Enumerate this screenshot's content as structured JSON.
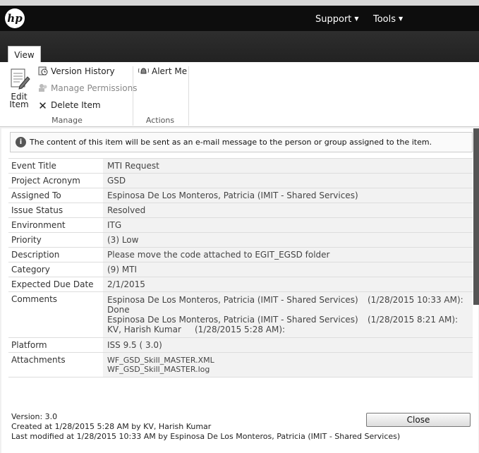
{
  "header": {
    "logo_text": "hp",
    "nav": [
      {
        "label": "Support"
      },
      {
        "label": "Tools"
      }
    ]
  },
  "ribbon": {
    "tabs": [
      {
        "label": "View"
      }
    ],
    "manage": {
      "edit_label_1": "Edit",
      "edit_label_2": "Item",
      "version_history": "Version History",
      "manage_permissions": "Manage Permissions",
      "delete_item": "Delete Item",
      "group_label": "Manage"
    },
    "actions": {
      "alert_me": "Alert Me",
      "group_label": "Actions"
    }
  },
  "info_message": "The content of this item will be sent as an e-mail message to the person or group assigned to the item.",
  "fields": {
    "event_title": {
      "label": "Event Title",
      "value": "MTI Request"
    },
    "project_acronym": {
      "label": "Project Acronym",
      "value": "GSD"
    },
    "assigned_to": {
      "label": "Assigned To",
      "value": "Espinosa De Los Monteros, Patricia (IMIT - Shared Services)"
    },
    "issue_status": {
      "label": "Issue Status",
      "value": "Resolved"
    },
    "environment": {
      "label": "Environment",
      "value": "ITG"
    },
    "priority": {
      "label": "Priority",
      "value": "(3) Low"
    },
    "description": {
      "label": "Description",
      "value": "Please move the code attached to EGIT_EGSD folder"
    },
    "category": {
      "label": "Category",
      "value": "(9) MTI"
    },
    "due_date": {
      "label": "Expected Due Date",
      "value": "2/1/2015"
    },
    "comments": {
      "label": "Comments",
      "entries": [
        {
          "author": "Espinosa De Los Monteros, Patricia (IMIT - Shared Services)",
          "time": "(1/28/2015 10:33 AM):",
          "text": "Done"
        },
        {
          "author": "Espinosa De Los Monteros, Patricia (IMIT - Shared Services)",
          "time": "(1/28/2015 8:21 AM):",
          "text": ""
        },
        {
          "author": "KV, Harish Kumar",
          "time": "(1/28/2015 5:28 AM):",
          "text": ""
        }
      ]
    },
    "platform": {
      "label": "Platform",
      "value": "ISS 9.5 ( 3.0)"
    },
    "attachments": {
      "label": "Attachments",
      "files": [
        "WF_GSD_Skill_MASTER.XML",
        "WF_GSD_Skill_MASTER.log"
      ]
    }
  },
  "footer": {
    "version": "Version: 3.0",
    "created": "Created at 1/28/2015 5:28 AM by KV, Harish Kumar",
    "modified": "Last modified at 1/28/2015 10:33 AM by Espinosa De Los Monteros, Patricia (IMIT - Shared Services)",
    "close_label": "Close"
  }
}
